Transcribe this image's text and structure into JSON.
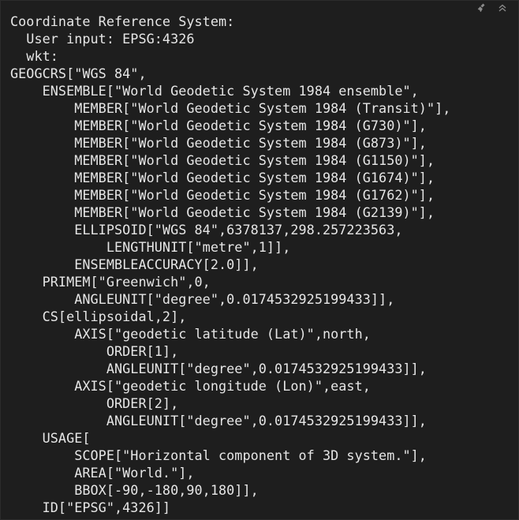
{
  "toolbar": {
    "icons": [
      "broom-icon",
      "collapse-up-icon"
    ]
  },
  "output": {
    "lines": [
      "Coordinate Reference System:",
      "  User input: EPSG:4326",
      "  wkt:",
      "GEOGCRS[\"WGS 84\",",
      "    ENSEMBLE[\"World Geodetic System 1984 ensemble\",",
      "        MEMBER[\"World Geodetic System 1984 (Transit)\"],",
      "        MEMBER[\"World Geodetic System 1984 (G730)\"],",
      "        MEMBER[\"World Geodetic System 1984 (G873)\"],",
      "        MEMBER[\"World Geodetic System 1984 (G1150)\"],",
      "        MEMBER[\"World Geodetic System 1984 (G1674)\"],",
      "        MEMBER[\"World Geodetic System 1984 (G1762)\"],",
      "        MEMBER[\"World Geodetic System 1984 (G2139)\"],",
      "        ELLIPSOID[\"WGS 84\",6378137,298.257223563,",
      "            LENGTHUNIT[\"metre\",1]],",
      "        ENSEMBLEACCURACY[2.0]],",
      "    PRIMEM[\"Greenwich\",0,",
      "        ANGLEUNIT[\"degree\",0.0174532925199433]],",
      "    CS[ellipsoidal,2],",
      "        AXIS[\"geodetic latitude (Lat)\",north,",
      "            ORDER[1],",
      "            ANGLEUNIT[\"degree\",0.0174532925199433]],",
      "        AXIS[\"geodetic longitude (Lon)\",east,",
      "            ORDER[2],",
      "            ANGLEUNIT[\"degree\",0.0174532925199433]],",
      "    USAGE[",
      "        SCOPE[\"Horizontal component of 3D system.\"],",
      "        AREA[\"World.\"],",
      "        BBOX[-90,-180,90,180]],",
      "    ID[\"EPSG\",4326]]"
    ]
  },
  "colors": {
    "background": "#1e1e1e",
    "text": "#e6e6e6",
    "icon": "#8a8a8a"
  }
}
